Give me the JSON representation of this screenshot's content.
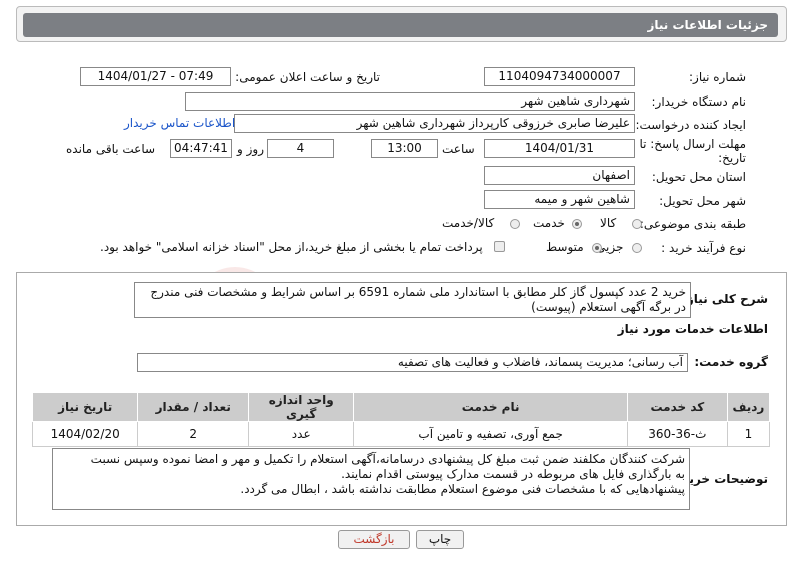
{
  "header": {
    "title": "جزئیات اطلاعات نیاز"
  },
  "fields": {
    "need_number_label": "شماره نیاز:",
    "need_number": "1104094734000007",
    "announce_label": "تاریخ و ساعت اعلان عمومی:",
    "announce_value": "1404/01/27 - 07:49",
    "buyer_org_label": "نام دستگاه خریدار:",
    "buyer_org": "شهرداری شاهین شهر",
    "creator_label": "ایجاد کننده درخواست:",
    "creator": "علیرضا صابری خرزوقی کارپرداز شهرداری شاهین شهر",
    "contact_link": "اطلاعات تماس خریدار",
    "deadline_label_1": "مهلت ارسال پاسخ: تا",
    "deadline_label_2": "تاریخ:",
    "deadline_date": "1404/01/31",
    "time_label": "ساعت",
    "deadline_time": "13:00",
    "days_count": "4",
    "days_label": "روز و",
    "remaining_time": "04:47:41",
    "remaining_label": "ساعت باقی مانده",
    "province_label": "استان محل تحویل:",
    "province": "اصفهان",
    "city_label": "شهر محل تحویل:",
    "city": "شاهین شهر و میمه",
    "category_label": "طبقه بندی موضوعی:",
    "category_options": [
      "کالا",
      "خدمت",
      "کالا/خدمت"
    ],
    "category_selected": "خدمت",
    "process_label": "نوع فرآیند خرید :",
    "process_options": [
      "جزیی",
      "متوسط"
    ],
    "process_selected": "متوسط",
    "treasury_note": "پرداخت تمام یا بخشی از مبلغ خرید،از محل \"اسناد خزانه اسلامی\" خواهد بود."
  },
  "description": {
    "label": "شرح کلی نیاز:",
    "text": "خرید 2 عدد کپسول گاز کلر مطابق با استاندارد ملی شماره 6591 بر اساس شرایط و مشخصات فنی مندرج در برگه آگهی استعلام (پیوست)"
  },
  "services": {
    "section_title": "اطلاعات خدمات مورد نیاز",
    "group_label": "گروه خدمت:",
    "group_value": "آب رسانی؛ مدیریت پسماند، فاضلاب و فعالیت های تصفیه",
    "columns": [
      "ردیف",
      "کد خدمت",
      "نام خدمت",
      "واحد اندازه گیری",
      "تعداد / مقدار",
      "تاریخ نیاز"
    ],
    "rows": [
      [
        "1",
        "ث-36-360",
        "جمع آوری، تصفیه و تامین آب",
        "عدد",
        "2",
        "1404/02/20"
      ]
    ]
  },
  "buyer_notes": {
    "label": "توضیحات خریدار:",
    "lines": [
      "شرکت کنندگان مکلفند ضمن ثبت مبلغ کل پیشنهادی درسامانه،آگهی استعلام را  تکمیل و مهر و امضا نموده وسپس نسبت",
      "به بارگذاری فایل های مربوطه در قسمت مدارک پیوستی اقدام نمایند.",
      "پیشنهادهایی که با مشخصات فنی موضوع استعلام مطابقت نداشته باشد ، ابطال می گردد."
    ]
  },
  "buttons": {
    "print": "چاپ",
    "back": "بازگشت"
  },
  "watermark_text": "AriaTender.neT",
  "colors": {
    "header_bg": "#7c7f84",
    "link": "#1b55c9",
    "back_text": "#c0392b",
    "watermark": "#d9534f"
  }
}
